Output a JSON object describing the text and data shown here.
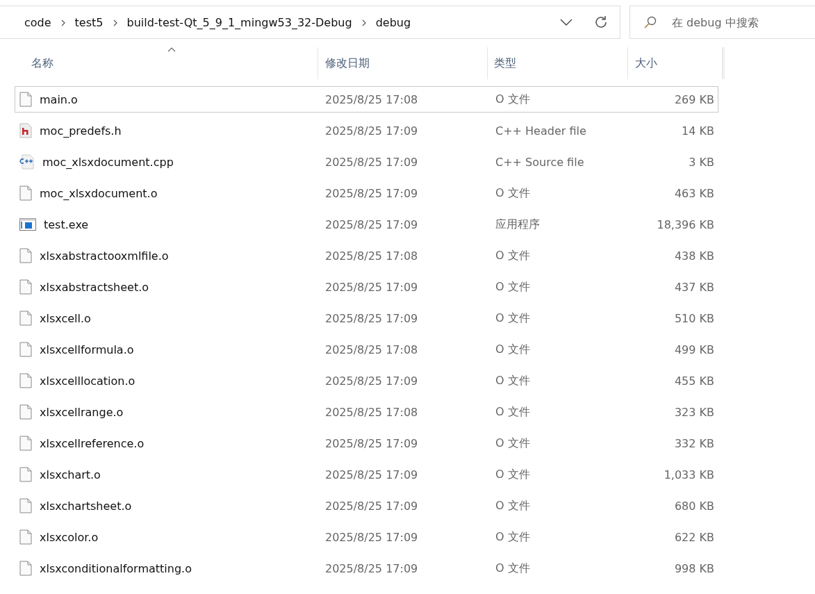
{
  "address_bar": {
    "crumbs": [
      "code",
      "test5",
      "build-test-Qt_5_9_1_mingw53_32-Debug",
      "debug"
    ]
  },
  "search": {
    "placeholder": "在 debug 中搜索"
  },
  "columns": [
    {
      "label": "名称",
      "sorted": true
    },
    {
      "label": "修改日期",
      "sorted": false
    },
    {
      "label": "类型",
      "sorted": false
    },
    {
      "label": "大小",
      "sorted": false
    }
  ],
  "files": [
    {
      "kind": "blank",
      "name": "main.o",
      "modified": "2025/8/25 17:08",
      "type": "O 文件",
      "size": "269 KB",
      "focused": true
    },
    {
      "kind": "header",
      "name": "moc_predefs.h",
      "modified": "2025/8/25 17:09",
      "type": "C++ Header file",
      "size": "14 KB",
      "focused": false
    },
    {
      "kind": "cpp",
      "name": "moc_xlsxdocument.cpp",
      "modified": "2025/8/25 17:09",
      "type": "C++ Source file",
      "size": "3 KB",
      "focused": false
    },
    {
      "kind": "blank",
      "name": "moc_xlsxdocument.o",
      "modified": "2025/8/25 17:09",
      "type": "O 文件",
      "size": "463 KB",
      "focused": false
    },
    {
      "kind": "exe",
      "name": "test.exe",
      "modified": "2025/8/25 17:09",
      "type": "应用程序",
      "size": "18,396 KB",
      "focused": false
    },
    {
      "kind": "blank",
      "name": "xlsxabstractooxmlfile.o",
      "modified": "2025/8/25 17:08",
      "type": "O 文件",
      "size": "438 KB",
      "focused": false
    },
    {
      "kind": "blank",
      "name": "xlsxabstractsheet.o",
      "modified": "2025/8/25 17:09",
      "type": "O 文件",
      "size": "437 KB",
      "focused": false
    },
    {
      "kind": "blank",
      "name": "xlsxcell.o",
      "modified": "2025/8/25 17:09",
      "type": "O 文件",
      "size": "510 KB",
      "focused": false
    },
    {
      "kind": "blank",
      "name": "xlsxcellformula.o",
      "modified": "2025/8/25 17:08",
      "type": "O 文件",
      "size": "499 KB",
      "focused": false
    },
    {
      "kind": "blank",
      "name": "xlsxcelllocation.o",
      "modified": "2025/8/25 17:09",
      "type": "O 文件",
      "size": "455 KB",
      "focused": false
    },
    {
      "kind": "blank",
      "name": "xlsxcellrange.o",
      "modified": "2025/8/25 17:08",
      "type": "O 文件",
      "size": "323 KB",
      "focused": false
    },
    {
      "kind": "blank",
      "name": "xlsxcellreference.o",
      "modified": "2025/8/25 17:09",
      "type": "O 文件",
      "size": "332 KB",
      "focused": false
    },
    {
      "kind": "blank",
      "name": "xlsxchart.o",
      "modified": "2025/8/25 17:09",
      "type": "O 文件",
      "size": "1,033 KB",
      "focused": false
    },
    {
      "kind": "blank",
      "name": "xlsxchartsheet.o",
      "modified": "2025/8/25 17:09",
      "type": "O 文件",
      "size": "680 KB",
      "focused": false
    },
    {
      "kind": "blank",
      "name": "xlsxcolor.o",
      "modified": "2025/8/25 17:09",
      "type": "O 文件",
      "size": "622 KB",
      "focused": false
    },
    {
      "kind": "blank",
      "name": "xlsxconditionalformatting.o",
      "modified": "2025/8/25 17:09",
      "type": "O 文件",
      "size": "998 KB",
      "focused": false
    }
  ]
}
